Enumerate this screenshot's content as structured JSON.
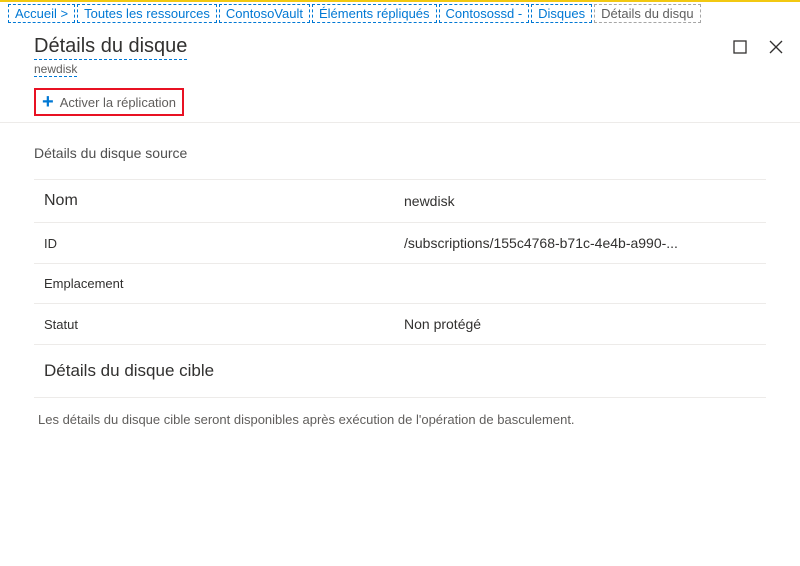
{
  "breadcrumb": {
    "home": "Accueil",
    "sep": ">",
    "all_resources": "Toutes les ressources",
    "vault": "ContosoVault",
    "replicated_items": "Éléments répliqués",
    "vm": "Contosossd",
    "dash": "-",
    "disks": "Disques",
    "details": "Détails du disqu"
  },
  "header": {
    "title": "Détails du disque",
    "subtitle": "newdisk"
  },
  "command": {
    "enable_replication": "Activer la réplication"
  },
  "source": {
    "section_label": "Détails du disque source",
    "name_label": "Nom",
    "name_value": "newdisk",
    "id_label": "ID",
    "id_value": "/subscriptions/155c4768-b71c-4e4b-a990-...",
    "location_label": "Emplacement",
    "location_value": "",
    "status_label": "Statut",
    "status_value": "Non protégé"
  },
  "target": {
    "heading": "Détails du disque cible",
    "message": "Les détails du disque cible seront disponibles après exécution de l'opération de basculement."
  }
}
